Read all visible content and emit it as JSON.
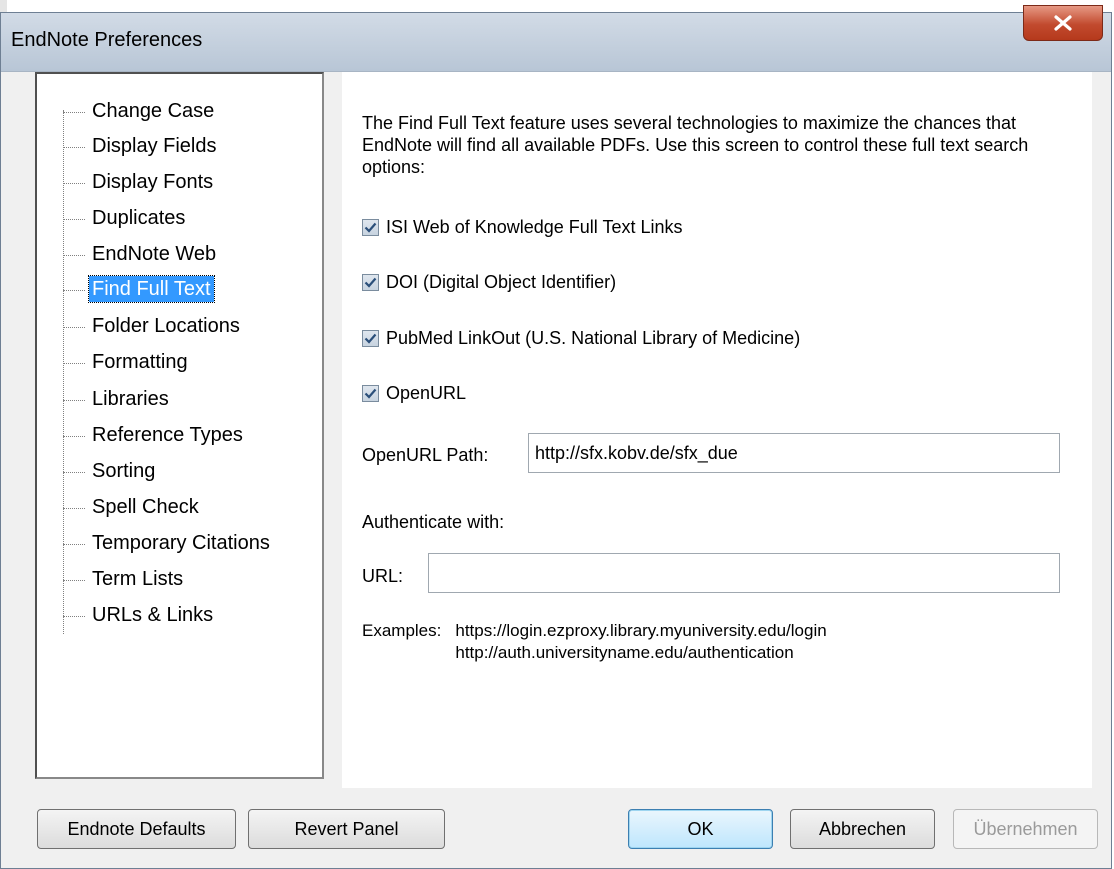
{
  "window": {
    "title": "EndNote Preferences",
    "close_icon": "close-icon"
  },
  "tree": {
    "items": [
      {
        "label": "Change Case"
      },
      {
        "label": "Display Fields"
      },
      {
        "label": "Display Fonts"
      },
      {
        "label": "Duplicates"
      },
      {
        "label": "EndNote Web"
      },
      {
        "label": "Find Full Text",
        "selected": true
      },
      {
        "label": "Folder Locations"
      },
      {
        "label": "Formatting"
      },
      {
        "label": "Libraries"
      },
      {
        "label": "Reference Types"
      },
      {
        "label": "Sorting"
      },
      {
        "label": "Spell Check"
      },
      {
        "label": "Temporary Citations"
      },
      {
        "label": "Term Lists"
      },
      {
        "label": "URLs & Links"
      }
    ]
  },
  "panel": {
    "description": "The Find Full Text feature uses several technologies to maximize the chances that EndNote will find all available PDFs. Use this screen to control these full text search options:",
    "options": [
      {
        "label": "ISI Web of Knowledge Full Text Links",
        "checked": true
      },
      {
        "label": "DOI (Digital Object Identifier)",
        "checked": true
      },
      {
        "label": "PubMed LinkOut (U.S. National Library of Medicine)",
        "checked": true
      },
      {
        "label": "OpenURL",
        "checked": true
      }
    ],
    "openurl_path_label": "OpenURL Path:",
    "openurl_path_value": "http://sfx.kobv.de/sfx_due",
    "authenticate_label": "Authenticate with:",
    "url_label": "URL:",
    "url_value": "",
    "examples_label": "Examples:",
    "examples": [
      "https://login.ezproxy.library.myuniversity.edu/login",
      "http://auth.universityname.edu/authentication"
    ]
  },
  "buttons": {
    "endnote_defaults": "Endnote Defaults",
    "revert_panel": "Revert Panel",
    "ok": "OK",
    "cancel": "Abbrechen",
    "apply": "Übernehmen"
  },
  "colors": {
    "selection": "#3399ff",
    "close_button": "#c24a2e"
  }
}
